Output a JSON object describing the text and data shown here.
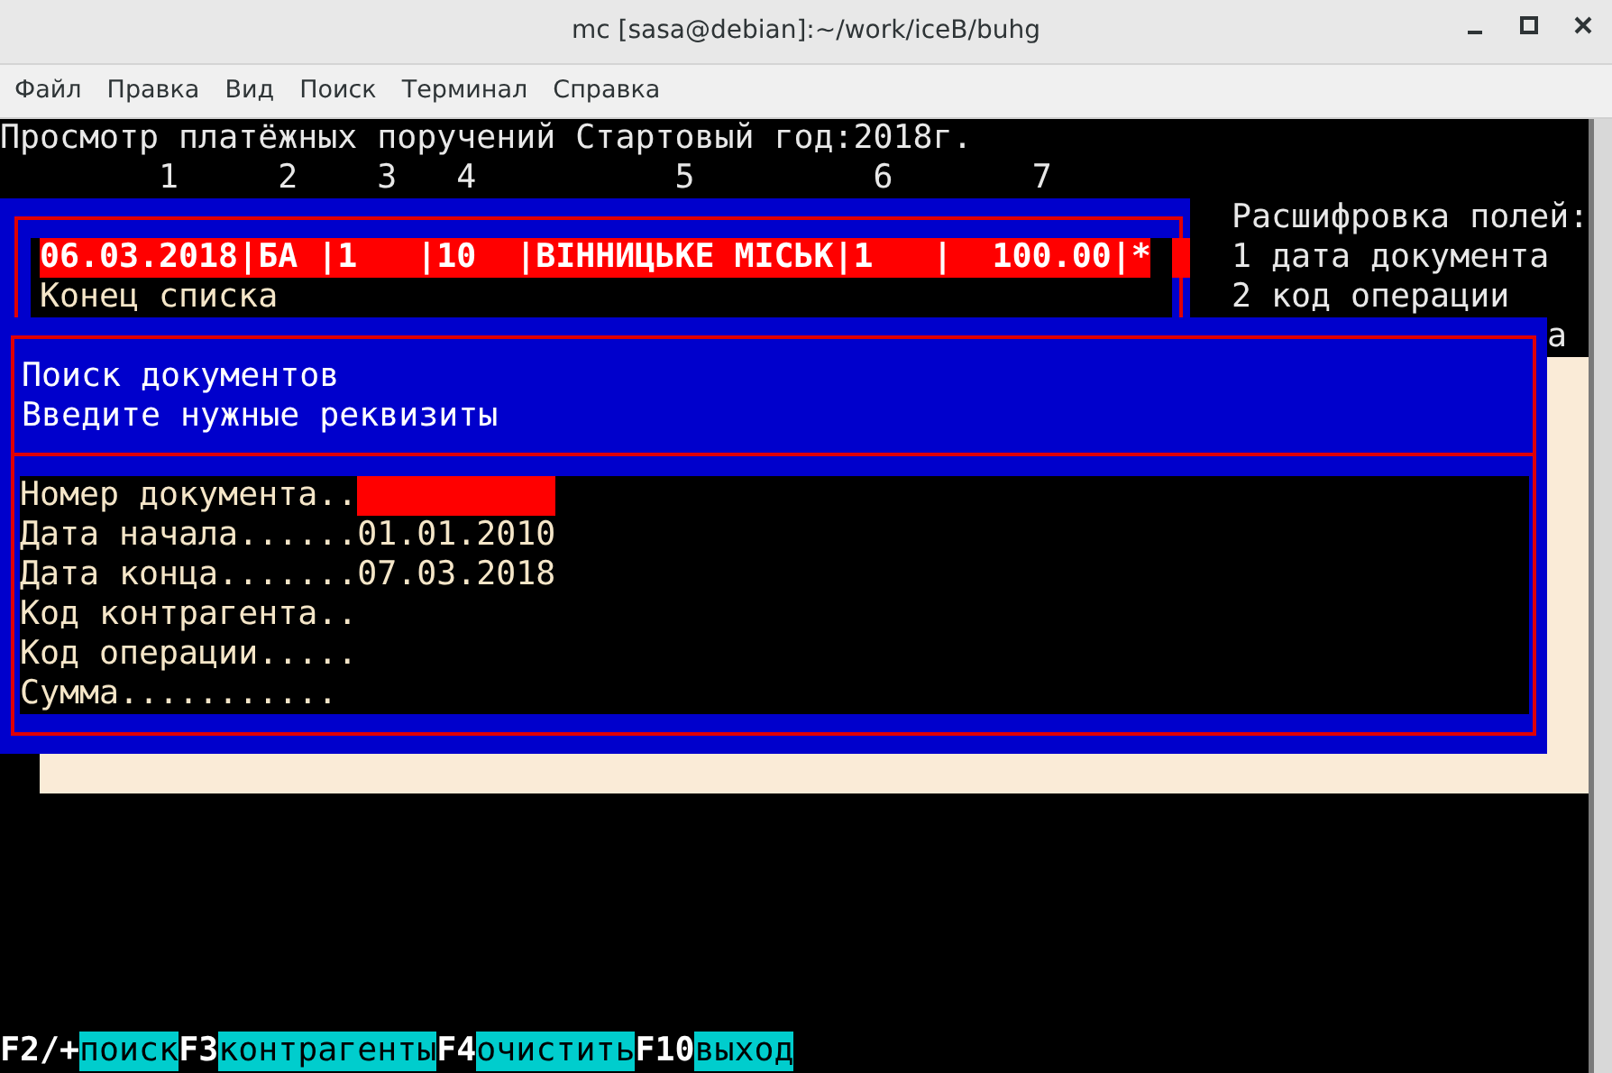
{
  "window": {
    "title": "mc [sasa@debian]:~/work/iceB/buhg"
  },
  "menu": [
    "Файл",
    "Правка",
    "Вид",
    "Поиск",
    "Терминал",
    "Справка"
  ],
  "terminal": {
    "header": "Просмотр платёжных поручений Стартовый год:2018г.",
    "column_numbers": "        1     2    3   4          5         6       7",
    "list": {
      "rows": [
        {
          "text": "06.03.2018|БА |1   |10  |ВІННИЦЬКЕ МІСЬК|1   |  100.00|*",
          "selected": true
        }
      ],
      "end_label": "Конец списка"
    },
    "legend": [
      "Расшифровка полей:",
      "1 дата документа",
      "2 код операции",
      "а"
    ],
    "dialog": {
      "title_lines": [
        "Поиск документов",
        "Введите нужные реквизиты"
      ],
      "fields": [
        {
          "label": "Номер документа..",
          "focused": true
        },
        {
          "label": "Дата начала......",
          "value": "01.01.2010",
          "focused": false
        },
        {
          "label": "Дата конца.......",
          "value": "07.03.2018",
          "focused": false
        },
        {
          "label": "Код контрагента..",
          "focused": false
        },
        {
          "label": "Код операции.....",
          "focused": false
        },
        {
          "label": "Сумма...........",
          "focused": false
        }
      ]
    },
    "function_keys": [
      {
        "key": "F2/+",
        "label": "поиск"
      },
      {
        "key": "F3",
        "label": "контрагенты"
      },
      {
        "key": "F4",
        "label": "очистить"
      },
      {
        "key": "F10",
        "label": "выход"
      }
    ]
  }
}
